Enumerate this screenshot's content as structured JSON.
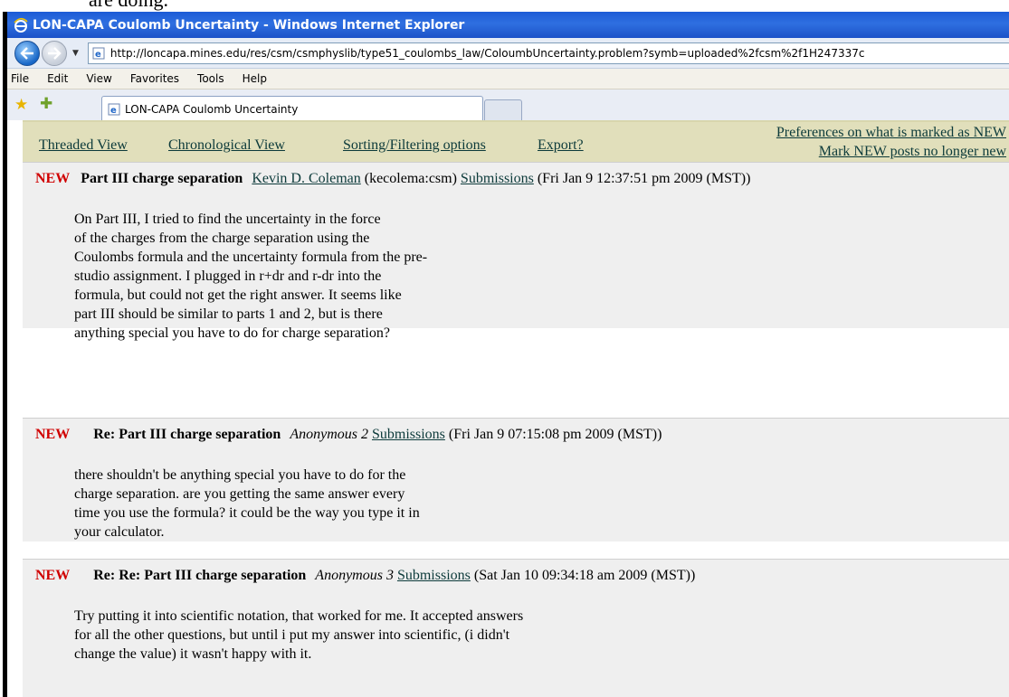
{
  "doc_fragment": "are doing.",
  "window": {
    "title": "LON-CAPA Coulomb Uncertainty - Windows Internet Explorer"
  },
  "address_bar": {
    "url": "http://loncapa.mines.edu/res/csm/csmphyslib/type51_coulombs_law/ColoumbUncertainty.problem?symb=uploaded%2fcsm%2f1H247337c"
  },
  "menu": [
    "File",
    "Edit",
    "View",
    "Favorites",
    "Tools",
    "Help"
  ],
  "tab": {
    "label": "LON-CAPA Coulomb Uncertainty"
  },
  "toolbar": {
    "threaded_view": "Threaded View",
    "chronological_view": "Chronological View",
    "sorting": "Sorting/Filtering options",
    "export": "Export?",
    "preferences": "Preferences on what is marked as NEW",
    "mark_new": "Mark NEW posts no longer new"
  },
  "posts": [
    {
      "tag": "NEW",
      "title": "Part III charge separation",
      "author": "Kevin D. Coleman",
      "author_id": "(kecolema:csm)",
      "submissions": "Submissions",
      "timestamp": "(Fri Jan 9 12:37:51 pm 2009 (MST))",
      "body": [
        "On Part III, I tried to find the uncertainty in the force",
        "of the charges from the charge separation using the",
        "Coulombs formula and the uncertainty formula from the pre-",
        "studio assignment. I plugged in r+dr and r-dr into the",
        "formula, but could not get the right answer. It seems like",
        "part III should be similar to parts 1 and 2, but is there",
        "anything special you have to do for charge separation?"
      ]
    },
    {
      "tag": "NEW",
      "title": "Re: Part III charge separation",
      "author": "Anonymous 2",
      "submissions": "Submissions",
      "timestamp": "(Fri Jan 9 07:15:08 pm 2009 (MST))",
      "body": [
        "there shouldn't be anything special you have to do for the",
        "charge separation. are you getting the same answer every",
        "time you use the formula? it could be the way you type it in",
        "your calculator."
      ]
    },
    {
      "tag": "NEW",
      "title": "Re: Re: Part III charge separation",
      "author": "Anonymous 3",
      "submissions": "Submissions",
      "timestamp": "(Sat Jan 10 09:34:18 am 2009 (MST))",
      "body": [
        "Try putting it into scientific notation, that worked for me. It accepted answers",
        "for all the other questions, but until i put my answer into scientific, (i didn't",
        "change the value) it wasn't happy with it."
      ]
    }
  ]
}
